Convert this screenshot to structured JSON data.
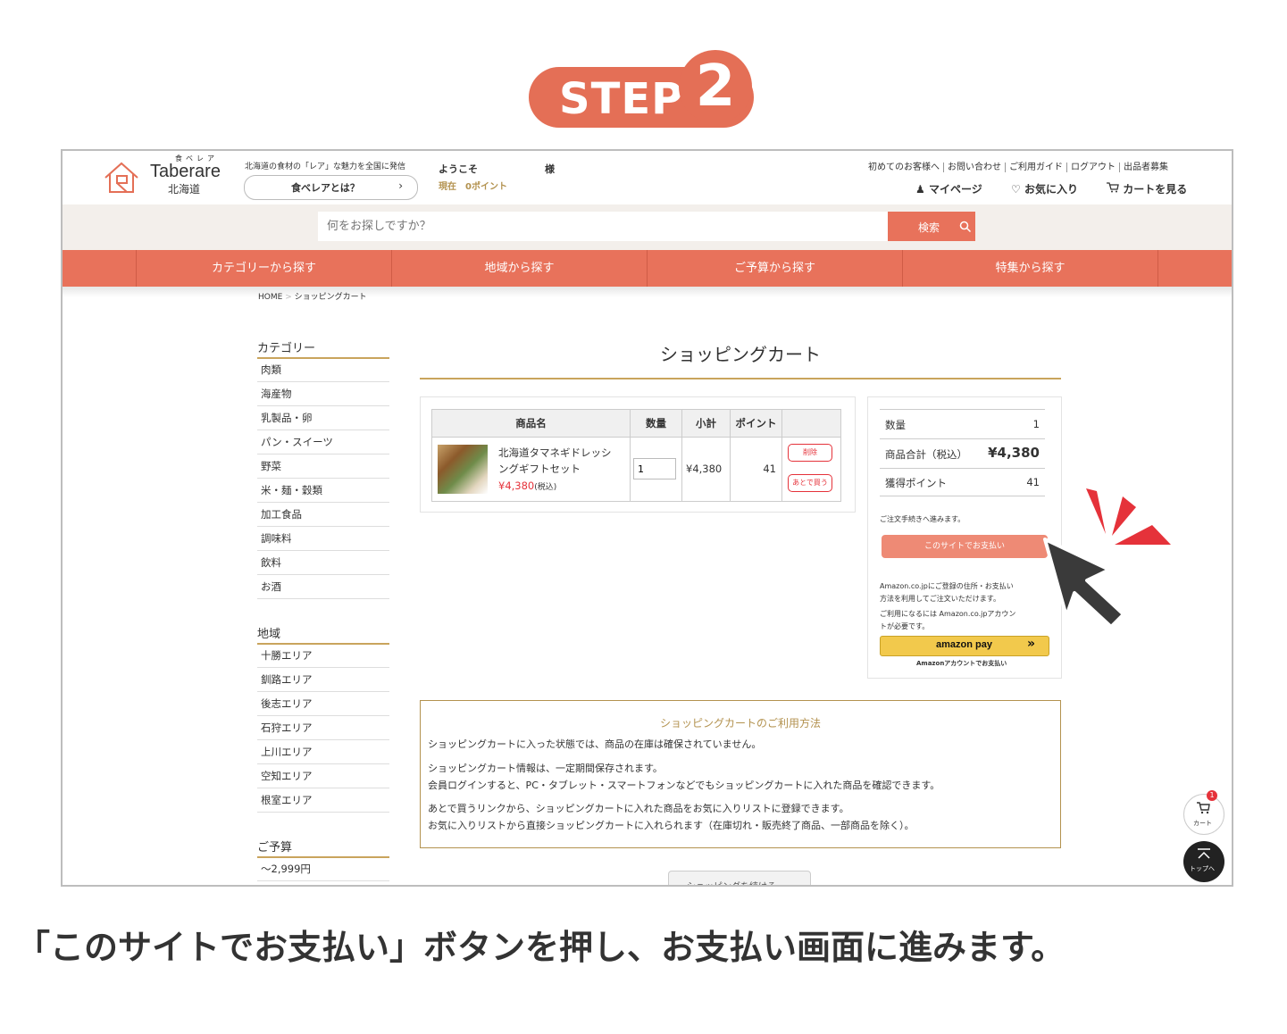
{
  "step": {
    "label": "STEP",
    "number": "2"
  },
  "header": {
    "logo_kana": "食ベレア",
    "logo_en": "Taberare",
    "logo_jp": "北海道",
    "tagline": "北海道の食材の「レア」な魅力を全国に発信",
    "about_button": "食べレアとは？",
    "about_chevron": "›",
    "welcome": "ようこそ",
    "sama": "様",
    "points_label": "現在　0ポイント",
    "top_links": [
      "初めてのお客様へ",
      "お問い合わせ",
      "ご利用ガイド",
      "ログアウト",
      "出品者募集"
    ],
    "mypage": "マイページ",
    "favorites": "お気に入り",
    "view_cart": "カートを見る"
  },
  "search": {
    "placeholder": "何をお探しですか？",
    "button": "検索"
  },
  "nav": [
    "カテゴリーから探す",
    "地域から探す",
    "ご予算から探す",
    "特集から探す"
  ],
  "breadcrumb": {
    "home": "HOME",
    "sep": ">",
    "current": "ショッピングカート"
  },
  "sidebar": {
    "category_title": "カテゴリー",
    "categories": [
      "肉類",
      "海産物",
      "乳製品・卵",
      "パン・スイーツ",
      "野菜",
      "米・麺・穀類",
      "加工食品",
      "調味料",
      "飲料",
      "お酒"
    ],
    "region_title": "地域",
    "regions": [
      "十勝エリア",
      "釧路エリア",
      "後志エリア",
      "石狩エリア",
      "上川エリア",
      "空知エリア",
      "根室エリア"
    ],
    "budget_title": "ご予算",
    "budgets": [
      "～2,999円"
    ]
  },
  "cart": {
    "title": "ショッピングカート",
    "columns": {
      "name": "商品名",
      "qty": "数量",
      "subtotal": "小計",
      "points": "ポイント"
    },
    "item": {
      "name_line1": "北海道タマネギドレッシ",
      "name_line2": "ングギフトセット",
      "price": "¥4,380",
      "tax": "(税込)",
      "qty": "1",
      "subtotal": "¥4,380",
      "points": "41",
      "delete": "削除",
      "later": "あとで買う"
    }
  },
  "summary": {
    "qty_label": "数量",
    "qty": "1",
    "total_label": "商品合計（税込）",
    "total": "¥4,380",
    "points_label": "獲得ポイント",
    "points": "41",
    "proceed_note": "ご注文手続きへ進みます。",
    "pay_button": "このサイトでお支払い",
    "amazon_note1": "Amazon.co.jpにご登録の住所・お支払い",
    "amazon_note2": "方法を利用してご注文いただけます。",
    "amazon_note3": "ご利用になるには Amazon.co.jpアカウン",
    "amazon_note4": "トが必要です。",
    "amazon_button": "amazon pay",
    "amazon_arrows": "»",
    "amazon_caption": "Amazonアカウントでお支払い"
  },
  "howto": {
    "title": "ショッピングカートのご利用方法",
    "p1": "ショッピングカートに入った状態では、商品の在庫は確保されていません。",
    "p2a": "ショッピングカート情報は、一定期間保存されます。",
    "p2b": "会員ログインすると、PC・タブレット・スマートフォンなどでもショッピングカートに入れた商品を確認できます。",
    "p3a": "あとで買うリンクから、ショッピングカートに入れた商品をお気に入りリストに登録できます。",
    "p3b": "お気に入りリストから直接ショッピングカートに入れられます（在庫切れ・販売終了商品、一部商品を除く）。"
  },
  "continue_button": "ショッピングを続ける",
  "floats": {
    "cart_badge": "1",
    "cart_label": "カート",
    "top_label": "トップへ"
  },
  "caption": "「このサイトでお支払い」ボタンを押し、お支払い画面に進みます。",
  "colors": {
    "accent": "#e8725b",
    "gold": "#b3924f",
    "price_red": "#e5323a"
  }
}
